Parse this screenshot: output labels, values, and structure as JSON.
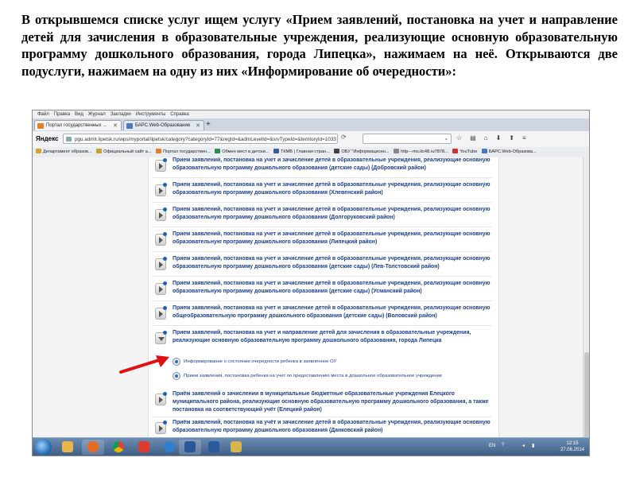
{
  "caption": "В открывшемся списке услуг ищем услугу «Прием заявлений, постановка на учет и направление детей для зачисления в образовательные учреждения, реализующие основную образовательную программу дошкольного образования, города Липецка», нажимаем на неё. Открываются две подуслуги, нажимаем на одну из них «Информирование об очередности»:",
  "browser": {
    "menu": [
      "Файл",
      "Правка",
      "Вид",
      "Журнал",
      "Закладки",
      "Инструменты",
      "Справка"
    ],
    "tabs": [
      {
        "label": "Портал государственных ..."
      },
      {
        "label": "БАРС.Web-Образование"
      }
    ],
    "new_tab": "+",
    "yandex_label": "Яндекс",
    "url": "pgu.admlr.lipetsk.ru/wps/myportal/lipetsk/category?categoryId=77&regId=&admLevelId=&srvTypeId=&territoryId=1033",
    "search_placeholder": "",
    "bookmarks": [
      {
        "label": "Департамент образов...",
        "icon": "#d9a32b"
      },
      {
        "label": "Официальный сайт а...",
        "icon": "#c9a230"
      },
      {
        "label": "Портал государствен...",
        "icon": "#e67e22"
      },
      {
        "label": "Обмен мест в детски...",
        "icon": "#2e8b57"
      },
      {
        "label": "ТКМВ | Главная стран...",
        "icon": "#3a5aa0"
      },
      {
        "label": "ОБУ \"Информационн...",
        "icon": "#444444"
      },
      {
        "label": "http---mo.itc48.ru7878...",
        "icon": "#888888"
      },
      {
        "label": "YouTube",
        "icon": "#d32f2f"
      },
      {
        "label": "БАРС.Web-Образова...",
        "icon": "#4a7ab8"
      }
    ]
  },
  "services": [
    {
      "text": "Прием заявлений, постановка на учет и зачисление детей в образовательные учреждения, реализующие основную образовательную программу дошкольного образования (детские сады) (Добровский район)"
    },
    {
      "text": "Прием заявлений, постановка на учет и зачисление детей в образовательные учреждения, реализующие основную образовательную программу дошкольного образования (Хлевенский район)"
    },
    {
      "text": "Прием заявлений, постановка на учет и зачисление детей в образовательные учреждения, реализующие основную образовательную программу дошкольного образования (Долгоруковский район)"
    },
    {
      "text": "Прием заявлений, постановка на учет и зачисление детей в образовательные учреждения, реализующие основную образовательную программу дошкольного образования (Липецкий район)"
    },
    {
      "text": "Прием заявлений, постановка на учет и зачисление детей в образовательные учреждения, реализующие основную образовательную программу дошкольного образования (детские сады) (Лев-Толстовский район)"
    },
    {
      "text": "Прием заявлений, постановка на учет и зачисление детей в образовательные учреждения, реализующие основную образовательную программу дошкольного образования (детские сады) (Усманский район)"
    },
    {
      "text": "Прием заявлений, постановка на учет и зачисление детей в образовательные учреждения, реализующие основную общеобразовательную программу дошкольного образования (детские сады) (Воловский район)"
    },
    {
      "text": "Прием заявлений, постановка на учет и направление детей для зачисления в образовательные учреждения, реализующие основную образовательную программу дошкольного образования, города Липецка"
    }
  ],
  "subservices": [
    {
      "text": "Информирование о состоянии очередности ребенка в заявленное ОУ"
    },
    {
      "text": "Прием заявления, постановка ребенка на учет по предоставлению места в дошкольное образовательное учреждение"
    }
  ],
  "services_after": [
    {
      "text": "Приём заявлений о зачислении в муниципальные бюджетные образовательные учреждения Елецкого муниципального района, реализующие основную образовательную программу дошкольного образования, а также постановка на соответствующий учёт (Елецкий район)"
    },
    {
      "text": "Приём заявлений, постановка на учёт и зачисление детей в образовательные учреждения, реализующие основную образовательную программу дошкольного образования (Данковский район)"
    }
  ],
  "taskbar": {
    "lang": "EN",
    "time": "12:15",
    "date": "27.06.2014",
    "apps": [
      {
        "name": "windows-explorer-icon",
        "color": "#e8b64a"
      },
      {
        "name": "firefox-icon",
        "color": "#e66a1f"
      },
      {
        "name": "chrome-icon",
        "color": "#3fa34d"
      },
      {
        "name": "yandex-browser-icon",
        "color": "#e03a2e"
      },
      {
        "name": "internet-explorer-icon",
        "color": "#2f7fd3"
      },
      {
        "name": "word-icon",
        "color": "#2b5797"
      },
      {
        "name": "media-player-icon",
        "color": "#2a5a9b"
      },
      {
        "name": "file-manager-icon",
        "color": "#d8b54a"
      }
    ]
  },
  "colors": {
    "link": "#1a3d8f",
    "arrow": "#e01010"
  }
}
